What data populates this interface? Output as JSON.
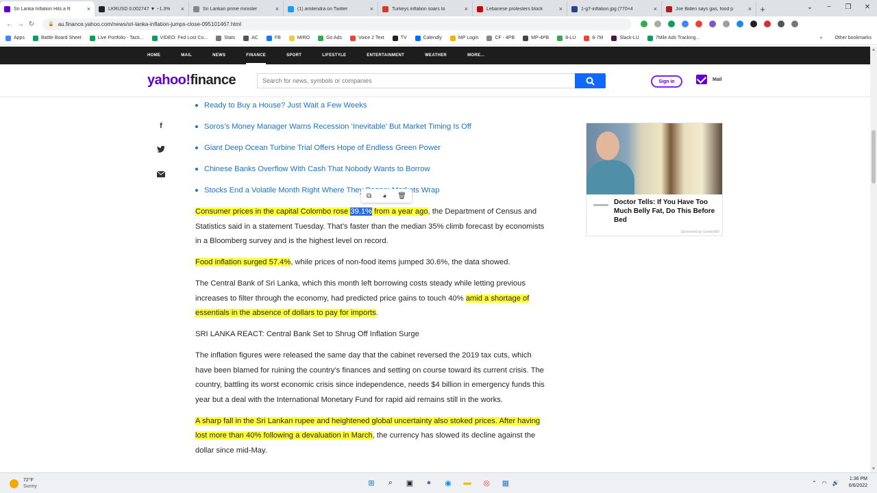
{
  "browser": {
    "tabs": [
      {
        "title": "Sri Lanka Inflation Hits a R",
        "color": "#6001d2",
        "active": true
      },
      {
        "title": "LKRUSD 0.002747 ▼ −1.3%",
        "color": "#222222"
      },
      {
        "title": "Sri Lankan prime minister",
        "color": "#888888"
      },
      {
        "title": "(1) amilendra on Twitter",
        "color": "#1d9bf0"
      },
      {
        "title": "Turkeys inflation soars to",
        "color": "#d33b2c"
      },
      {
        "title": "Lebanese protesters block",
        "color": "#cc0000"
      },
      {
        "title": "1-g7-inflation.jpg (770×4",
        "color": "#2a3f8f"
      },
      {
        "title": "Joe Biden says gas, food p",
        "color": "#b31b1b"
      }
    ],
    "close_glyph": "×",
    "new_tab_glyph": "+",
    "window_controls": {
      "chevron": "⌄",
      "minimize": "−",
      "maximize": "❐",
      "close": "✕"
    },
    "nav": {
      "back": "←",
      "forward": "→",
      "reload": "↻"
    },
    "url": "au.finance.yahoo.com/news/sri-lanka-inflation-jumps-close-095101467.html",
    "bookmarks": [
      {
        "label": "Apps",
        "color": "#4285f4"
      },
      {
        "label": "Battle Board Sheet",
        "color": "#0f9d58"
      },
      {
        "label": "Live Portfolio - Tacti...",
        "color": "#0f9d58"
      },
      {
        "label": "VIDEO: Fed Lost Co...",
        "color": "#0f9d58"
      },
      {
        "label": "Stats",
        "color": "#777777"
      },
      {
        "label": "AC",
        "color": "#555555"
      },
      {
        "label": "FB",
        "color": "#1877f2"
      },
      {
        "label": "MIRO",
        "color": "#f2c94c"
      },
      {
        "label": "Go Ads",
        "color": "#34a853"
      },
      {
        "label": "Voice 2 Text",
        "color": "#ea4335"
      },
      {
        "label": "TV",
        "color": "#222222"
      },
      {
        "label": "Calendly",
        "color": "#006bff"
      },
      {
        "label": "MP Login",
        "color": "#f4b400"
      },
      {
        "label": "CF - 4PB",
        "color": "#888888"
      },
      {
        "label": "MP-4PB",
        "color": "#444444"
      },
      {
        "label": "8-LU",
        "color": "#34a853"
      },
      {
        "label": "8-7M",
        "color": "#ea4335"
      },
      {
        "label": "Slack-LU",
        "color": "#4a154b"
      },
      {
        "label": "7Mile Ads Tracking...",
        "color": "#0f9d58"
      }
    ],
    "bookmarks_more": "»",
    "other_bookmarks": "Other bookmarks"
  },
  "yahoo": {
    "nav_items": [
      "HOME",
      "MAIL",
      "NEWS",
      "FINANCE",
      "SPORT",
      "LIFESTYLE",
      "ENTERTAINMENT",
      "WEATHER",
      "MORE..."
    ],
    "logo_y": "yahoo!",
    "logo_f": "finance",
    "search_placeholder": "Search for news, symbols or companies",
    "signin": "Sign in",
    "mail": "Mail",
    "brand_color": "#6001d2"
  },
  "share_icons": [
    {
      "name": "facebook-icon",
      "glyph": "f"
    },
    {
      "name": "twitter-icon",
      "glyph": "🐦"
    },
    {
      "name": "email-icon",
      "glyph": "✉"
    }
  ],
  "article": {
    "related_links": [
      "Ready to Buy a House? Just Wait a Few Weeks",
      "Soros’s Money Manager Warns Recession ‘Inevitable’ But Market Timing Is Off",
      "Giant Deep Ocean Turbine Trial Offers Hope of Endless Green Power",
      "Chinese Banks Overflow With Cash That Nobody Wants to Borrow",
      "Stocks End a Volatile Month Right Where They Began: Markets Wrap"
    ],
    "p1": {
      "hl1": "Consumer prices in the capital Colombo rose ",
      "selected": "39.1%",
      "hl2": " from a year ago",
      "rest": ", the Department of Census and Statistics said in a statement Tuesday. That’s faster than the median 35% climb forecast by economists in a Bloomberg survey and is the highest level on record."
    },
    "p2": {
      "hl": "Food inflation surged 57.4%",
      "rest": ", while prices of non-food items jumped 30.6%, the data showed."
    },
    "p3": {
      "text": "The Central Bank of Sri Lanka, which this month left borrowing costs steady while letting previous increases to filter through the economy, had predicted price gains to touch 40% ",
      "hl": "amid a shortage of essentials in the absence of dollars to pay for imports",
      "end": "."
    },
    "p4": "SRI LANKA REACT: Central Bank Set to Shrug Off Inflation Surge",
    "p5": "The inflation figures were released the same day that the cabinet reversed the 2019 tax cuts, which have been blamed for ruining the country’s finances and setting on course toward its current crisis. The country, battling its worst economic crisis since independence, needs $4 billion in emergency funds this year but a deal with the International Monetary Fund for rapid aid remains still in the works.",
    "p6": {
      "hl": "A sharp fall in the Sri Lankan rupee and heightened global uncertainty also stoked prices. After having lost more than 40% following a devaluation in March",
      "rest": ", the currency has slowed its decline against the dollar since mid-May."
    }
  },
  "floating_toolbar": [
    {
      "name": "copy-icon",
      "glyph": "⧉"
    },
    {
      "name": "palette-icon",
      "glyph": "◕"
    },
    {
      "name": "trash-icon",
      "glyph": "🗑"
    }
  ],
  "ad": {
    "headline": "Doctor Tells: If You Have Too Much Belly Fat, Do This Before Bed",
    "sponsor": "Sponsored by GundryMD"
  },
  "taskbar": {
    "temp": "72°F",
    "condition": "Sunny",
    "icons": [
      {
        "name": "windows-start-icon",
        "glyph": "⊞",
        "color": "#0078d4"
      },
      {
        "name": "search-icon",
        "glyph": "⌕",
        "color": "#222222"
      },
      {
        "name": "task-view-icon",
        "glyph": "▣",
        "color": "#222222"
      },
      {
        "name": "chat-icon",
        "glyph": "●",
        "color": "#6264a7"
      },
      {
        "name": "edge-icon",
        "glyph": "◉",
        "color": "#0c8ce9"
      },
      {
        "name": "file-explorer-icon",
        "glyph": "▬",
        "color": "#f2b90d"
      },
      {
        "name": "chrome-icon",
        "glyph": "◎",
        "color": "#db4437"
      },
      {
        "name": "photos-icon",
        "glyph": "▦",
        "color": "#2a7bd4"
      }
    ],
    "tray": {
      "chevron": "⌃",
      "wifi": "◠",
      "volume": "🔊"
    },
    "time": "1:36 PM",
    "date": "6/6/2022"
  }
}
